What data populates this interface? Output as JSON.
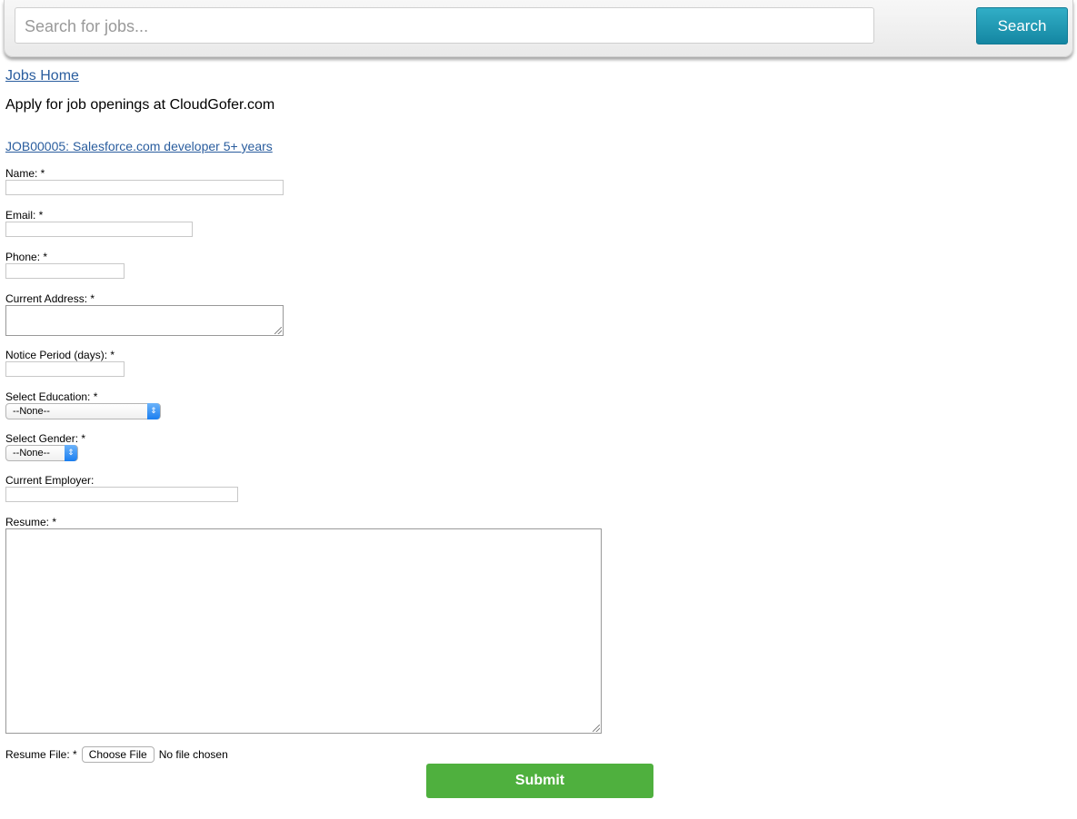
{
  "header": {
    "search_placeholder": "Search for jobs...",
    "search_button": "Search"
  },
  "nav": {
    "jobs_home": "Jobs Home "
  },
  "intro_text": "Apply for job openings at CloudGofer.com",
  "job_link": "JOB00005: Salesforce.com developer 5+ years ",
  "form": {
    "name_label": "Name: *",
    "name_value": "",
    "email_label": "Email: *",
    "email_value": "",
    "phone_label": "Phone: *",
    "phone_value": "",
    "address_label": "Current Address: *",
    "address_value": "",
    "notice_label": "Notice Period (days): *",
    "notice_value": "",
    "education_label": "Select Education: *",
    "education_selected": "--None--",
    "gender_label": "Select Gender: *",
    "gender_selected": "--None--",
    "employer_label": "Current Employer:",
    "employer_value": "",
    "resume_label": "Resume: *",
    "resume_value": "",
    "resume_file_label": "Resume File: *",
    "choose_file_button": "Choose File",
    "file_status": "No file chosen",
    "submit_label": "Submit"
  },
  "colors": {
    "link": "#2a5d9e",
    "search_button": "#1f9ab5",
    "submit_button": "#4fb03e"
  }
}
